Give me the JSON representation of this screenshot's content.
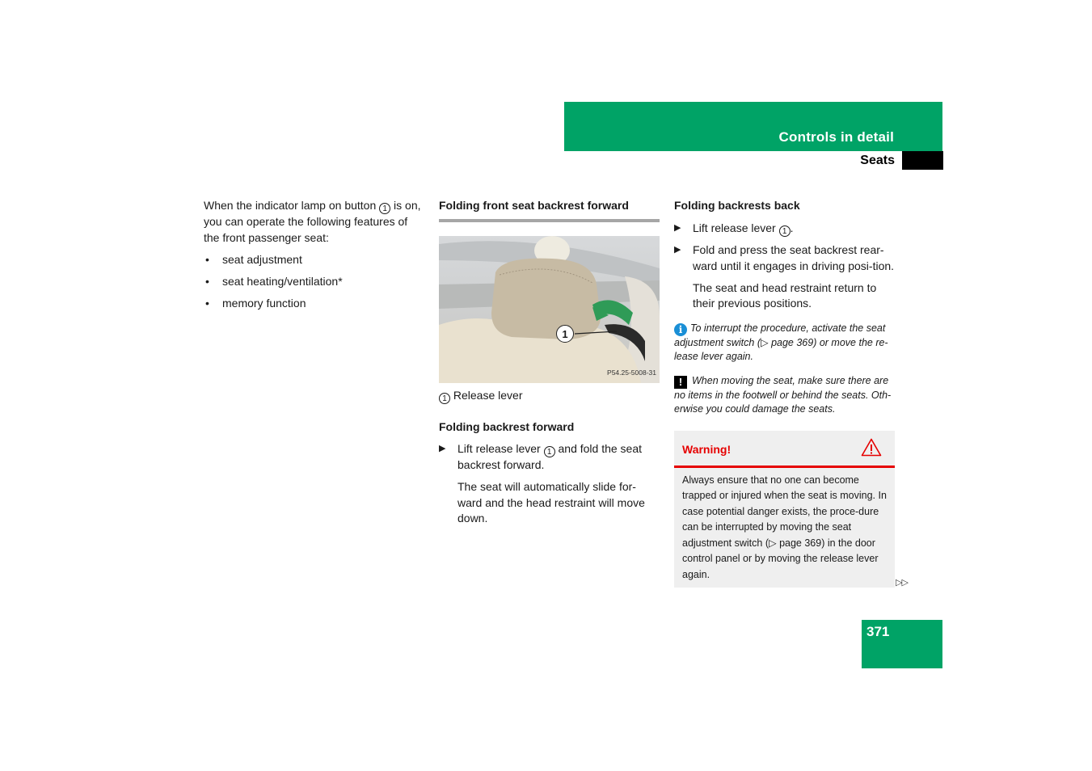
{
  "header": {
    "chapter": "Controls in detail",
    "section": "Seats",
    "accent_color": "#00a366"
  },
  "col1": {
    "intro_before": "When the indicator lamp on button ",
    "intro_callout": "1",
    "intro_after": " is on, you can operate the following features of the front passenger seat:",
    "bullet_glyph": "•",
    "features": [
      "seat adjustment",
      "seat heating/ventilation*",
      "memory function"
    ]
  },
  "col2": {
    "heading": "Folding front seat backrest forward",
    "figure": {
      "callout": "1",
      "code": "P54.25-5008-31"
    },
    "legend_callout": "1",
    "legend_label": "Release lever",
    "subheading": "Folding backrest forward",
    "step_glyph": "▶",
    "step1_before": "Lift release lever ",
    "step1_callout": "1",
    "step1_after": " and fold the seat backrest forward.",
    "result": "The seat will automatically slide for-ward and the head restraint will move down."
  },
  "col3": {
    "heading": "Folding backrests back",
    "step_glyph": "▶",
    "step1_before": "Lift release lever ",
    "step1_callout": "1",
    "step1_after": ".",
    "step2": "Fold and press the seat backrest rear-ward until it engages in driving posi-tion.",
    "result": "The seat and head restraint return to their previous positions.",
    "info_note": "To interrupt the procedure, activate the seat adjustment switch (▷ page 369) or move the re-lease lever again.",
    "caution_note": "When moving the seat, make sure there are no items in the footwell or behind the seats. Oth-erwise you could damage the seats.",
    "warning": {
      "title": "Warning!",
      "text": "Always ensure that no one can become trapped or injured when the seat is moving. In case potential danger exists, the proce-dure can be interrupted by moving the seat adjustment switch (▷ page 369) in the door control panel or by moving the release lever again.",
      "color": "#e60000"
    }
  },
  "continue_marker": "▷▷",
  "page_number": "371"
}
